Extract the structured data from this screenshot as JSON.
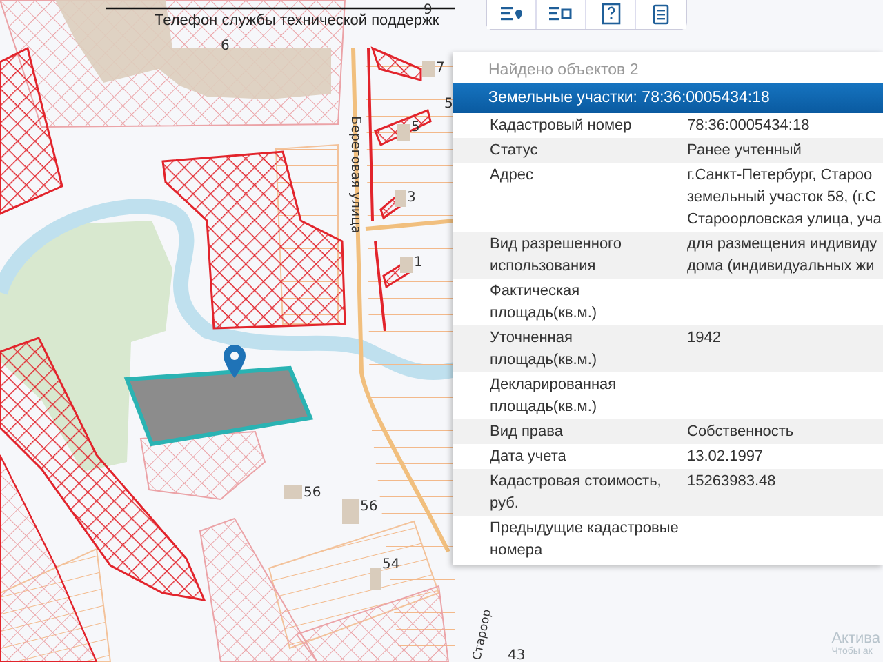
{
  "map": {
    "notice": "Телефон службы технической поддержк",
    "street_labels": [
      {
        "text": "Береговая улица"
      },
      {
        "text": "Староор"
      }
    ],
    "house_numbers": [
      "9",
      "6",
      "7",
      "5",
      "5",
      "3",
      "1",
      "56",
      "56",
      "54",
      "43"
    ]
  },
  "toolbar": {
    "buttons": [
      {
        "kind": "pin-list"
      },
      {
        "kind": "area-list"
      },
      {
        "kind": "help"
      },
      {
        "kind": "document"
      }
    ]
  },
  "panel": {
    "found": "Найдено объектов 2",
    "selected_result": "Земельные участки: 78:36:0005434:18",
    "rows": [
      {
        "label": "Кадастровый номер",
        "value": "78:36:0005434:18"
      },
      {
        "label": "Статус",
        "value": "Ранее учтенный"
      },
      {
        "label": "Адрес",
        "value": "г.Санкт-Петербург, Староо\nземельный участок 58, (г.С\nСтароорловская улица, уча"
      },
      {
        "label": "Вид разрешенного\nиспользования",
        "value": "для размещения индивиду\nдома (индивидуальных жи"
      },
      {
        "label": "Фактическая\nплощадь(кв.м.)"
      },
      {
        "label": "Уточненная\nплощадь(кв.м.)",
        "value": "1942"
      },
      {
        "label": "Декларированная\nплощадь(кв.м.)"
      },
      {
        "label": "Вид права",
        "value": "Собственность"
      },
      {
        "label": "Дата учета",
        "value": "13.02.1997"
      },
      {
        "label": "Кадастровая стоимость,\nруб.",
        "value": "15263983.48"
      },
      {
        "label": "Предыдущие кадастровые\nномера"
      }
    ]
  },
  "os_overlay": {
    "title": "Актива",
    "subtitle": "Чтобы ак"
  }
}
